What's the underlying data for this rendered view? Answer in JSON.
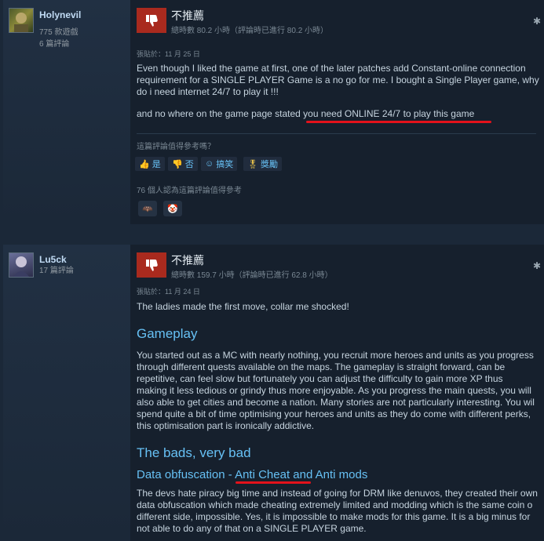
{
  "review1": {
    "username": "Holynevil",
    "games_owned": "775 款遊戲",
    "reviews_count": "6 篇評論",
    "verdict": "不推薦",
    "hours": "總時數 80.2 小時（評論時已進行 80.2 小時）",
    "posted": "張貼於：11 月 25 日",
    "body": [
      "Even though I liked the game at first, one of the later patches add Constant-online connection",
      "requirement for a SINGLE PLAYER Game is a no go for me. I bought a Single Player game, why",
      "do i need internet 24/7 to play it !!!",
      "",
      "and no where on the game page stated you need ONLINE 24/7 to play this game"
    ],
    "helpful_question": "這篇評論值得參考嗎？",
    "btn_yes": "是",
    "btn_no": "否",
    "btn_funny": "搞笑",
    "btn_award": "獎勵",
    "found_helpful": "76 個人認為這篇評論值得參考",
    "award_icons": [
      "bat-award-icon",
      "clown-award-icon"
    ]
  },
  "review2": {
    "username": "Lu5ck",
    "reviews_count": "17 篇評論",
    "verdict": "不推薦",
    "hours": "總時數 159.7 小時（評論時已進行 62.8 小時）",
    "posted": "張貼於：11 月 24 日",
    "intro": "The ladies made the first move, collar me shocked!",
    "heading_gameplay": "Gameplay",
    "gameplay_lines": [
      "You started out as a MC with nearly nothing, you recruit more heroes and units as you progress",
      "through different quests available on the maps. The gameplay is straight forward, can be",
      "repetitive, can feel slow but fortunately you can adjust the difficulty to gain more XP thus",
      "making it less tedious or grindy thus more enjoyable. As you progress the main quests, you will",
      "also able to get cities and become a nation. Many stories are not particularly interesting. You wil",
      "spend quite a bit of time optimising your heroes and units as they do come with different perks,",
      "this optimisation part is ironically addictive."
    ],
    "heading_bads": "The bads, very bad",
    "heading_obfuscation": "Data obfuscation - Anti Cheat and Anti mods",
    "obfuscation_lines": [
      "The devs hate piracy big time and instead of going for DRM like denuvos, they created their own",
      "data obfuscation which made cheating extremely limited and modding which is the same coin o",
      "different side, impossible. Yes, it is impossible to make mods for this game. It is a big minus for",
      "not able to do any of that on a SINGLE PLAYER game."
    ]
  },
  "colors": {
    "background": "#1b2838",
    "thumb_down": "#a92a1e",
    "heading": "#66c0f4",
    "annotation_underline": "#e3121b"
  }
}
